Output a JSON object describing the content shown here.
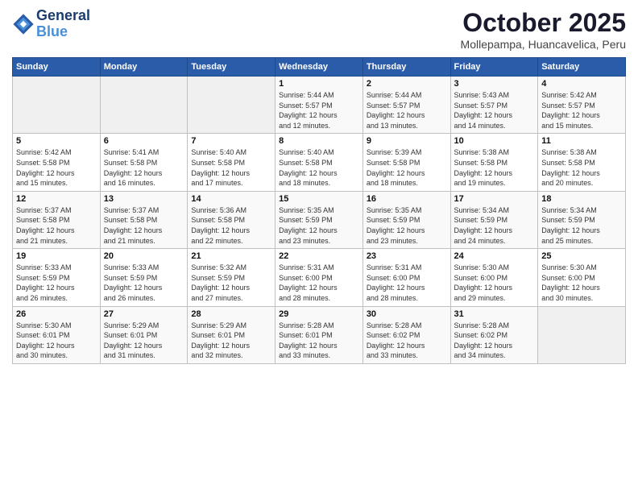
{
  "logo": {
    "line1": "General",
    "line2": "Blue"
  },
  "title": "October 2025",
  "subtitle": "Mollepampa, Huancavelica, Peru",
  "days_of_week": [
    "Sunday",
    "Monday",
    "Tuesday",
    "Wednesday",
    "Thursday",
    "Friday",
    "Saturday"
  ],
  "weeks": [
    [
      {
        "day": "",
        "info": ""
      },
      {
        "day": "",
        "info": ""
      },
      {
        "day": "",
        "info": ""
      },
      {
        "day": "1",
        "info": "Sunrise: 5:44 AM\nSunset: 5:57 PM\nDaylight: 12 hours\nand 12 minutes."
      },
      {
        "day": "2",
        "info": "Sunrise: 5:44 AM\nSunset: 5:57 PM\nDaylight: 12 hours\nand 13 minutes."
      },
      {
        "day": "3",
        "info": "Sunrise: 5:43 AM\nSunset: 5:57 PM\nDaylight: 12 hours\nand 14 minutes."
      },
      {
        "day": "4",
        "info": "Sunrise: 5:42 AM\nSunset: 5:57 PM\nDaylight: 12 hours\nand 15 minutes."
      }
    ],
    [
      {
        "day": "5",
        "info": "Sunrise: 5:42 AM\nSunset: 5:58 PM\nDaylight: 12 hours\nand 15 minutes."
      },
      {
        "day": "6",
        "info": "Sunrise: 5:41 AM\nSunset: 5:58 PM\nDaylight: 12 hours\nand 16 minutes."
      },
      {
        "day": "7",
        "info": "Sunrise: 5:40 AM\nSunset: 5:58 PM\nDaylight: 12 hours\nand 17 minutes."
      },
      {
        "day": "8",
        "info": "Sunrise: 5:40 AM\nSunset: 5:58 PM\nDaylight: 12 hours\nand 18 minutes."
      },
      {
        "day": "9",
        "info": "Sunrise: 5:39 AM\nSunset: 5:58 PM\nDaylight: 12 hours\nand 18 minutes."
      },
      {
        "day": "10",
        "info": "Sunrise: 5:38 AM\nSunset: 5:58 PM\nDaylight: 12 hours\nand 19 minutes."
      },
      {
        "day": "11",
        "info": "Sunrise: 5:38 AM\nSunset: 5:58 PM\nDaylight: 12 hours\nand 20 minutes."
      }
    ],
    [
      {
        "day": "12",
        "info": "Sunrise: 5:37 AM\nSunset: 5:58 PM\nDaylight: 12 hours\nand 21 minutes."
      },
      {
        "day": "13",
        "info": "Sunrise: 5:37 AM\nSunset: 5:58 PM\nDaylight: 12 hours\nand 21 minutes."
      },
      {
        "day": "14",
        "info": "Sunrise: 5:36 AM\nSunset: 5:58 PM\nDaylight: 12 hours\nand 22 minutes."
      },
      {
        "day": "15",
        "info": "Sunrise: 5:35 AM\nSunset: 5:59 PM\nDaylight: 12 hours\nand 23 minutes."
      },
      {
        "day": "16",
        "info": "Sunrise: 5:35 AM\nSunset: 5:59 PM\nDaylight: 12 hours\nand 23 minutes."
      },
      {
        "day": "17",
        "info": "Sunrise: 5:34 AM\nSunset: 5:59 PM\nDaylight: 12 hours\nand 24 minutes."
      },
      {
        "day": "18",
        "info": "Sunrise: 5:34 AM\nSunset: 5:59 PM\nDaylight: 12 hours\nand 25 minutes."
      }
    ],
    [
      {
        "day": "19",
        "info": "Sunrise: 5:33 AM\nSunset: 5:59 PM\nDaylight: 12 hours\nand 26 minutes."
      },
      {
        "day": "20",
        "info": "Sunrise: 5:33 AM\nSunset: 5:59 PM\nDaylight: 12 hours\nand 26 minutes."
      },
      {
        "day": "21",
        "info": "Sunrise: 5:32 AM\nSunset: 5:59 PM\nDaylight: 12 hours\nand 27 minutes."
      },
      {
        "day": "22",
        "info": "Sunrise: 5:31 AM\nSunset: 6:00 PM\nDaylight: 12 hours\nand 28 minutes."
      },
      {
        "day": "23",
        "info": "Sunrise: 5:31 AM\nSunset: 6:00 PM\nDaylight: 12 hours\nand 28 minutes."
      },
      {
        "day": "24",
        "info": "Sunrise: 5:30 AM\nSunset: 6:00 PM\nDaylight: 12 hours\nand 29 minutes."
      },
      {
        "day": "25",
        "info": "Sunrise: 5:30 AM\nSunset: 6:00 PM\nDaylight: 12 hours\nand 30 minutes."
      }
    ],
    [
      {
        "day": "26",
        "info": "Sunrise: 5:30 AM\nSunset: 6:01 PM\nDaylight: 12 hours\nand 30 minutes."
      },
      {
        "day": "27",
        "info": "Sunrise: 5:29 AM\nSunset: 6:01 PM\nDaylight: 12 hours\nand 31 minutes."
      },
      {
        "day": "28",
        "info": "Sunrise: 5:29 AM\nSunset: 6:01 PM\nDaylight: 12 hours\nand 32 minutes."
      },
      {
        "day": "29",
        "info": "Sunrise: 5:28 AM\nSunset: 6:01 PM\nDaylight: 12 hours\nand 33 minutes."
      },
      {
        "day": "30",
        "info": "Sunrise: 5:28 AM\nSunset: 6:02 PM\nDaylight: 12 hours\nand 33 minutes."
      },
      {
        "day": "31",
        "info": "Sunrise: 5:28 AM\nSunset: 6:02 PM\nDaylight: 12 hours\nand 34 minutes."
      },
      {
        "day": "",
        "info": ""
      }
    ]
  ]
}
